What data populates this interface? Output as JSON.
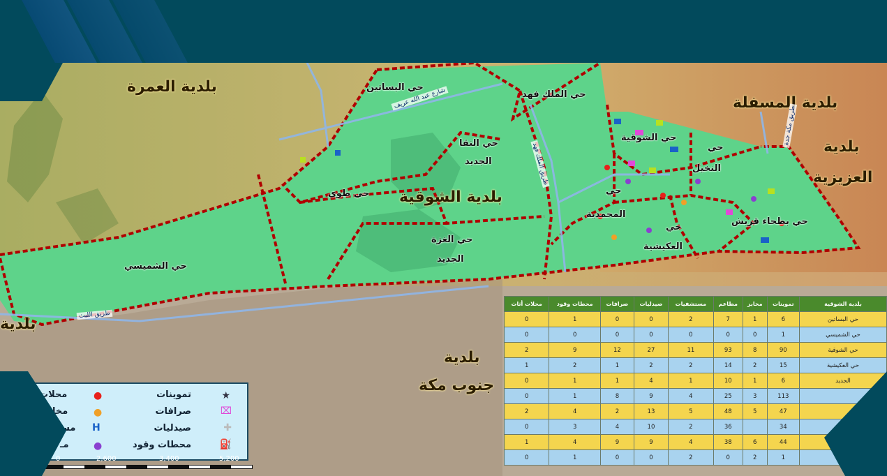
{
  "colors": {
    "frame": "#024a5c",
    "district_fill": "#5ed38a",
    "boundary": "#b00000",
    "table_header": "#4a8a2c",
    "row_yellow": "#f4d54e",
    "row_blue": "#a9d3ef"
  },
  "map": {
    "municipalities": {
      "umrah": "بلدية العمرة",
      "masfalah": "بلدية المسفلة",
      "aziziyah_1": "بلدية",
      "aziziyah_2": "العزيزية",
      "shawqiyah": "بلدية الشوقية",
      "south_1": "بلدية",
      "south_2": "جنوب مكة",
      "west_partial": "بلدية"
    },
    "districts": {
      "basateen": "حي البساتين",
      "malik_fahd": "حي الملك فهد",
      "naqa_1": "حي النقا",
      "naqa_2": "الجديد",
      "tuwa": "حي طوى",
      "shawqiyah": "حي الشوقية",
      "nakhil_1": "حي",
      "nakhil_2": "النخيل",
      "muhammadiyah_1": "حي",
      "muhammadiyah_2": "المحمدية",
      "akaishiyah_1": "حي",
      "akaishiyah_2": "العكيشية",
      "batha_quraysh": "حي بطحاء قريش",
      "ghazzah_1": "حي الغزة",
      "ghazzah_2": "الجديد",
      "shumaisi": "حي الشميسي"
    },
    "roads": {
      "r1": "طريق الليث",
      "r2": "طريق الملك فهد",
      "r3": "شارع عبد الله عريف",
      "r4": "طريق مكة جدة"
    }
  },
  "legend": {
    "col_right": [
      {
        "label": "تموينات",
        "icon": "star-icon",
        "color": "#334"
      },
      {
        "label": "صرافات",
        "icon": "atm-icon",
        "color": "#e04ad8"
      },
      {
        "label": "صيدليات",
        "icon": "pharmacy-icon",
        "color": "#ddd"
      },
      {
        "label": "محطات وقود",
        "icon": "fuel-icon",
        "color": "#b8e020"
      }
    ],
    "col_left": [
      {
        "label": "محلات",
        "icon": "dot-red-icon",
        "color": "#e8201a"
      },
      {
        "label": "مخابز",
        "icon": "dot-orange-icon",
        "color": "#f0a028"
      },
      {
        "label": "مس",
        "icon": "hospital-icon",
        "color": "#1a62c8"
      },
      {
        "label": "مـ",
        "icon": "dot-purple-icon",
        "color": "#8a40d0"
      }
    ]
  },
  "scale": {
    "ticks": [
      "0",
      "2,600",
      "3,400",
      "5,200"
    ],
    "unit": "m"
  },
  "table": {
    "headers": [
      "بلدية الشوقية",
      "تموينات",
      "مخابز",
      "مطاعم",
      "مستشفيات",
      "صيدليات",
      "صرافات",
      "محطات وقود",
      "محلات أثاث"
    ],
    "rows": [
      {
        "name": "حي البساتين",
        "values": [
          "6",
          "1",
          "7",
          "2",
          "0",
          "0",
          "1",
          "0"
        ]
      },
      {
        "name": "حي الشميسي",
        "values": [
          "1",
          "0",
          "0",
          "0",
          "0",
          "0",
          "0",
          "0"
        ]
      },
      {
        "name": "حي الشوقية",
        "values": [
          "90",
          "8",
          "93",
          "11",
          "27",
          "12",
          "9",
          "2"
        ]
      },
      {
        "name": "حي العكيشية",
        "values": [
          "15",
          "2",
          "14",
          "2",
          "2",
          "1",
          "2",
          "1"
        ]
      },
      {
        "name": "الجديد",
        "values": [
          "6",
          "1",
          "10",
          "1",
          "4",
          "1",
          "1",
          "0"
        ]
      },
      {
        "name": "",
        "values": [
          "113",
          "3",
          "25",
          "4",
          "9",
          "8",
          "1",
          "0"
        ]
      },
      {
        "name": "",
        "values": [
          "47",
          "5",
          "48",
          "5",
          "13",
          "2",
          "4",
          "2"
        ]
      },
      {
        "name": "",
        "values": [
          "34",
          "",
          "36",
          "2",
          "10",
          "4",
          "3",
          "0"
        ]
      },
      {
        "name": "",
        "values": [
          "44",
          "6",
          "38",
          "4",
          "9",
          "9",
          "4",
          "1"
        ]
      },
      {
        "name": "",
        "values": [
          "1",
          "2",
          "0",
          "2",
          "0",
          "0",
          "1",
          "0"
        ]
      }
    ]
  }
}
